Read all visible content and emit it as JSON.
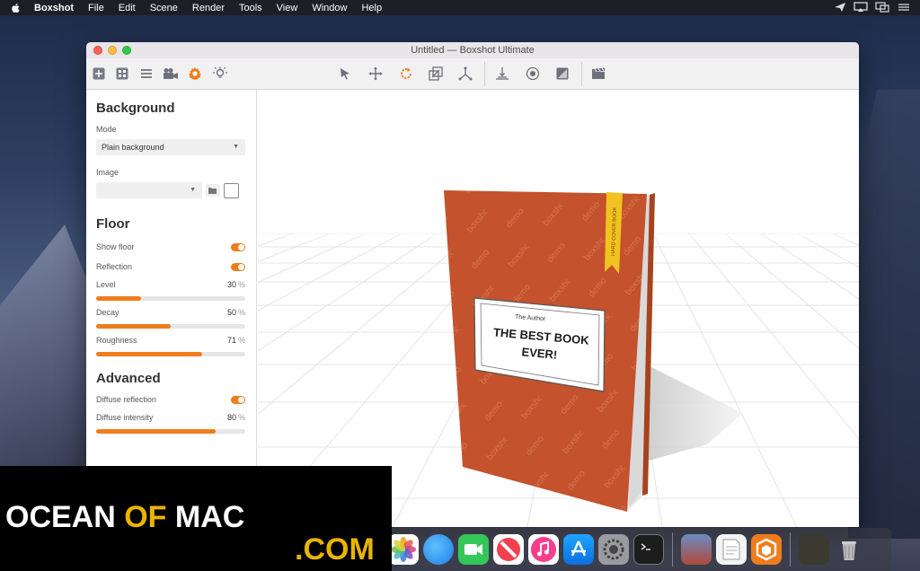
{
  "menubar": {
    "app": "Boxshot",
    "items": [
      "File",
      "Edit",
      "Scene",
      "Render",
      "Tools",
      "View",
      "Window",
      "Help"
    ]
  },
  "window": {
    "title": "Untitled — Boxshot Ultimate"
  },
  "sidebar": {
    "background": {
      "title": "Background",
      "mode_label": "Mode",
      "mode_value": "Plain background",
      "image_label": "Image",
      "image_value": ""
    },
    "floor": {
      "title": "Floor",
      "show_floor": "Show floor",
      "reflection": "Reflection",
      "level": {
        "label": "Level",
        "value": "30",
        "unit": "%",
        "fraction": 0.3
      },
      "decay": {
        "label": "Decay",
        "value": "50",
        "unit": "%",
        "fraction": 0.5
      },
      "roughness": {
        "label": "Roughness",
        "value": "71",
        "unit": "%",
        "fraction": 0.71
      }
    },
    "advanced": {
      "title": "Advanced",
      "diffuse_reflection": "Diffuse reflection",
      "diffuse_intensity": {
        "label": "Diffuse intensity",
        "value": "80",
        "unit": "%",
        "fraction": 0.8
      }
    }
  },
  "book": {
    "author": "The Author",
    "title_line1": "THE BEST BOOK",
    "title_line2": "EVER!",
    "ribbon": "HARD COVER BOOK",
    "pattern_a": "demo",
    "pattern_b": "boxshot"
  },
  "watermark": {
    "line1_a": "OCEAN ",
    "line1_b": "OF",
    "line1_c": " MAC",
    "line2": ".COM"
  },
  "colors": {
    "accent": "#ef7d1d",
    "book_cover": "#c4522c",
    "ribbon": "#f2c320"
  }
}
